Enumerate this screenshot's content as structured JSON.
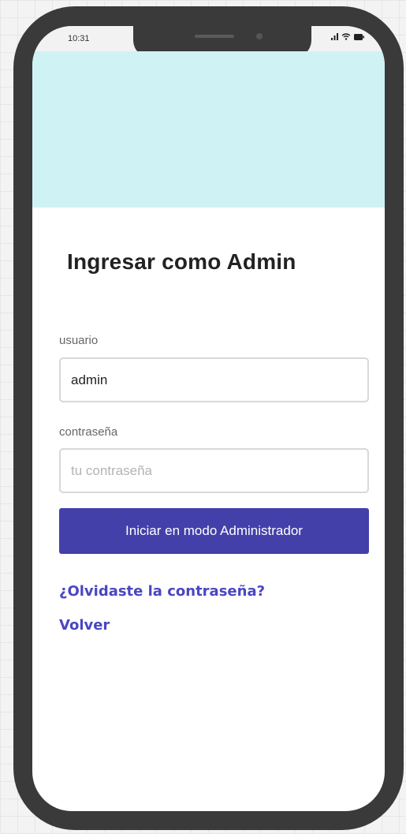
{
  "status_bar": {
    "time": "10:31"
  },
  "login": {
    "title": "Ingresar como Admin",
    "username_label": "usuario",
    "username_value": "admin",
    "password_label": "contraseña",
    "password_placeholder": "tu contraseña",
    "submit_label": "Iniciar en modo Administrador",
    "forgot_link": "¿Olvidaste la contraseña?",
    "back_link": "Volver"
  },
  "colors": {
    "accent": "#4340aa",
    "link": "#4a46c1",
    "hero": "#cff3f4",
    "device_frame": "#3a3a3a"
  },
  "icons": [
    "signal-icon",
    "wifi-icon",
    "battery-icon"
  ]
}
